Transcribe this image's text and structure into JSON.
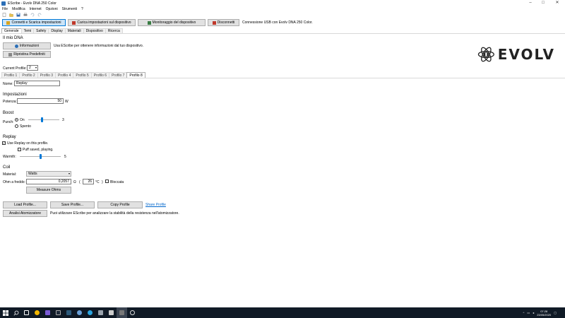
{
  "window": {
    "title": "EScribe - Evolv DNA 250 Color",
    "controls": [
      "–",
      "□",
      "✕"
    ]
  },
  "menu": [
    "File",
    "Modifica",
    "Internet",
    "Opzioni",
    "Strumenti",
    "?"
  ],
  "toolbar_icons": [
    "new-icon",
    "open-icon",
    "save-icon",
    "print-icon",
    "undo-icon",
    "redo-icon"
  ],
  "connection": {
    "connect_button": "Connetti e Scarica impostazioni",
    "upload_button": "Carica impostazioni sul dispositivo",
    "monitor_button": "Monitoraggio del dispositivo",
    "disconnect_button": "Disconnetti",
    "status": "Connessione USB con Evolv DNA 250 Color."
  },
  "tabs": [
    "Generale",
    "Temi",
    "Safety",
    "Display",
    "Materiali",
    "Dispositivo",
    "Ricerca"
  ],
  "active_tab": "Generale",
  "my_dna": {
    "title": "Il mio DNA",
    "info_button": "Informazioni",
    "info_desc": "Usa EScribe per ottenere informazioni dal tuo dispositivo.",
    "reset_button": "Ripristina Predefiniti"
  },
  "brand": "EVOLV",
  "current_profile": {
    "label": "Current Profile:",
    "value": "2"
  },
  "profile_tabs": [
    "Profilo 1",
    "Profilo 2",
    "Profilo 3",
    "Profilo 4",
    "Profilo 5",
    "Profilo 6",
    "Profilo 7",
    "Profilo 8"
  ],
  "active_profile_tab": "Profilo 8",
  "profile": {
    "name_label": "Nome:",
    "name_value": "Replay",
    "settings_title": "Impostazioni",
    "power_label": "Potenza:",
    "power_value": "50",
    "power_unit": "W",
    "boost_title": "Boost",
    "punch_label": "Punch:",
    "punch_on": "On",
    "punch_off": "Spento",
    "punch_value": "3",
    "punch_level": 0.45,
    "replay_title": "Replay",
    "use_replay_label": "Use Replay on this profile.",
    "use_replay_checked": true,
    "puff_saved_label": "Puff saved, playing.",
    "puff_saved_checked": false,
    "warmth_label": "Warmth:",
    "warmth_value": "5",
    "warmth_level": 0.5,
    "coil_title": "Coil",
    "material_label": "Material:",
    "material_value": "Watts",
    "ohms_label": "Ohm a freddo:",
    "ohms_value": "0,2057",
    "ohm_symbol": "Ω",
    "temp_open": "(",
    "temp_value": "26",
    "temp_unit": "°C",
    "temp_close": ")",
    "locked_label": "Bloccata",
    "measure_button": "Measure Ohms"
  },
  "actions": {
    "load_button": "Load Profile...",
    "save_button": "Save Profile...",
    "copy_button": "Copy Profile",
    "share_link": "Share Profile",
    "analyze_button": "Analisi Atomizzatore",
    "analyze_desc": "Puoi utilizzare EScribe per analizzare la stabilità della resistenza nell'atomizzatore."
  },
  "taskbar": {
    "time": "07:28",
    "date": "23/05/2020"
  }
}
